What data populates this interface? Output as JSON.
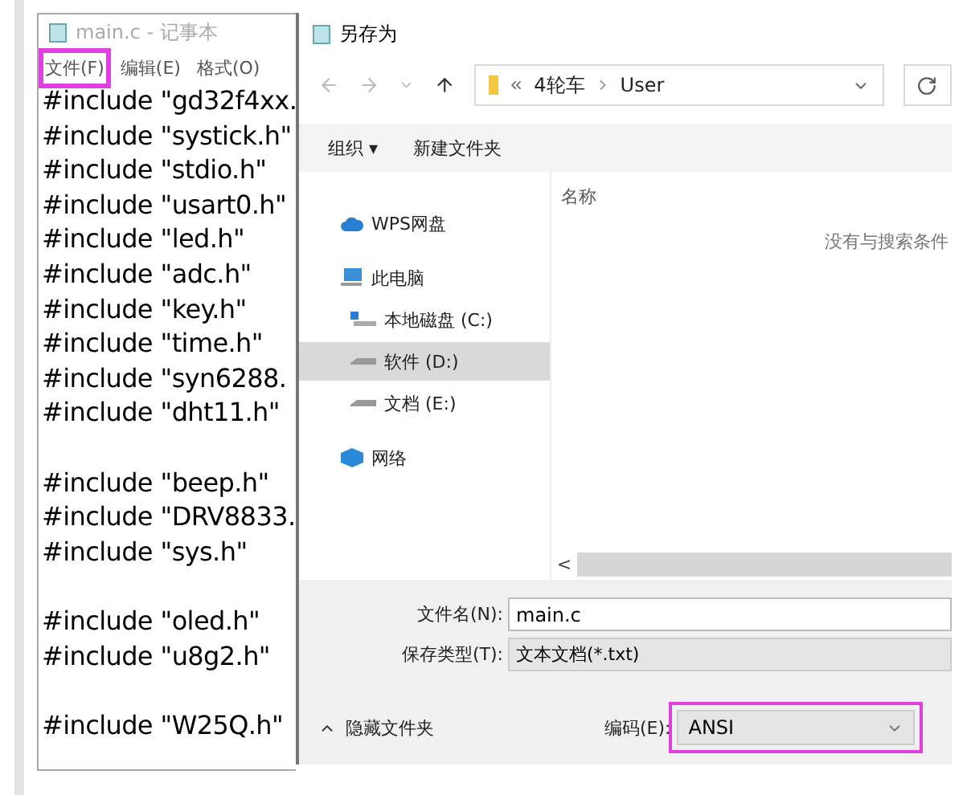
{
  "notepad": {
    "title": "main.c - 记事本",
    "menu": [
      {
        "label": "文件(F)",
        "highlighted": true
      },
      {
        "label": "编辑(E)",
        "highlighted": false
      },
      {
        "label": "格式(O)",
        "highlighted": false
      }
    ],
    "blocks": [
      [
        "#include \"gd32f4xx.",
        "#include \"systick.h\"",
        "#include \"stdio.h\"",
        "#include \"usart0.h\"",
        "#include \"led.h\"",
        "#include \"adc.h\"",
        "#include \"key.h\"",
        "#include \"time.h\"",
        "#include \"syn6288.",
        "#include \"dht11.h\""
      ],
      [
        "#include \"beep.h\"",
        "#include \"DRV8833.",
        "#include \"sys.h\""
      ],
      [
        "#include \"oled.h\"",
        "#include \"u8g2.h\""
      ],
      [
        "#include \"W25Q.h\""
      ]
    ]
  },
  "dialog": {
    "title": "另存为",
    "path": [
      "4轮车",
      "User"
    ],
    "toolbar": [
      "组织 ▾",
      "新建文件夹"
    ],
    "sidebar": [
      {
        "kind": "cloud",
        "label": "WPS网盘",
        "selected": false
      },
      {
        "kind": "pc",
        "label": "此电脑",
        "selected": false,
        "children": [
          {
            "kind": "disk",
            "label": "本地磁盘 (C:)",
            "selected": false
          },
          {
            "kind": "drive",
            "label": "软件 (D:)",
            "selected": true
          },
          {
            "kind": "drive",
            "label": "文档 (E:)",
            "selected": false
          }
        ]
      },
      {
        "kind": "network",
        "label": "网络",
        "selected": false
      }
    ],
    "column": "名称",
    "empty_message": "没有与搜索条件",
    "scroll_left": "<",
    "filename": {
      "label": "文件名(N):",
      "value": "main.c"
    },
    "filetype": {
      "label": "保存类型(T):",
      "value": "文本文档(*.txt)"
    },
    "hide_folders": "隐藏文件夹",
    "encoding": {
      "label": "编码(E):",
      "value": "ANSI",
      "highlighted": true
    }
  }
}
